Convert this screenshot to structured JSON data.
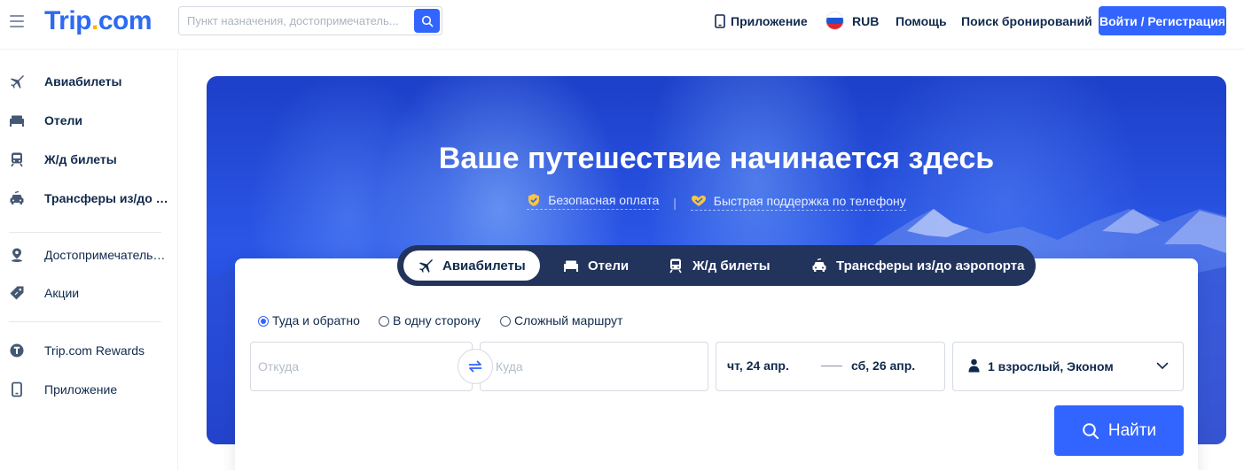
{
  "header": {
    "logo_main": "Trip",
    "logo_dot": ".",
    "logo_tail": "com",
    "search_placeholder": "Пункт назначения, достопримечатель...",
    "app_label": "Приложение",
    "currency": "RUB",
    "help": "Помощь",
    "find_booking": "Поиск бронирований",
    "login": "Войти / Регистрация"
  },
  "sidebar": {
    "items": [
      {
        "label": "Авиабилеты",
        "icon": "plane-icon"
      },
      {
        "label": "Отели",
        "icon": "bed-icon"
      },
      {
        "label": "Ж/д билеты",
        "icon": "train-icon"
      },
      {
        "label": "Трансферы из/до аэ...",
        "icon": "car-icon"
      },
      {
        "label": "Достопримечательно...",
        "icon": "map-pin-icon"
      },
      {
        "label": "Акции",
        "icon": "tag-icon"
      },
      {
        "label": "Trip.com Rewards",
        "icon": "rewards-icon"
      },
      {
        "label": "Приложение",
        "icon": "phone-icon"
      }
    ]
  },
  "hero": {
    "title": "Ваше путешествие начинается здесь",
    "badge_1": "Безопасная оплата",
    "badge_sep": "|",
    "badge_2": "Быстрая поддержка по телефону"
  },
  "search": {
    "tabs": [
      {
        "label": "Авиабилеты",
        "icon": "plane-icon",
        "active": true
      },
      {
        "label": "Отели",
        "icon": "bed-icon",
        "active": false
      },
      {
        "label": "Ж/д билеты",
        "icon": "train-icon",
        "active": false
      },
      {
        "label": "Трансферы из/до аэропорта",
        "icon": "car-icon",
        "active": false
      }
    ],
    "trip_types": [
      {
        "label": "Туда и обратно",
        "selected": true
      },
      {
        "label": "В одну сторону",
        "selected": false
      },
      {
        "label": "Сложный маршрут",
        "selected": false
      }
    ],
    "from_placeholder": "Откуда",
    "to_placeholder": "Куда",
    "depart_date": "чт, 24 апр.",
    "return_date": "сб, 26 апр.",
    "passengers": "1 взрослый, Эконом",
    "find_label": "Найти"
  },
  "colors": {
    "brand": "#3264ff",
    "logo_blue": "#2c6bf2",
    "logo_dot": "#ffb400",
    "text": "#0f294d",
    "tabs_bg": "#22335c"
  }
}
